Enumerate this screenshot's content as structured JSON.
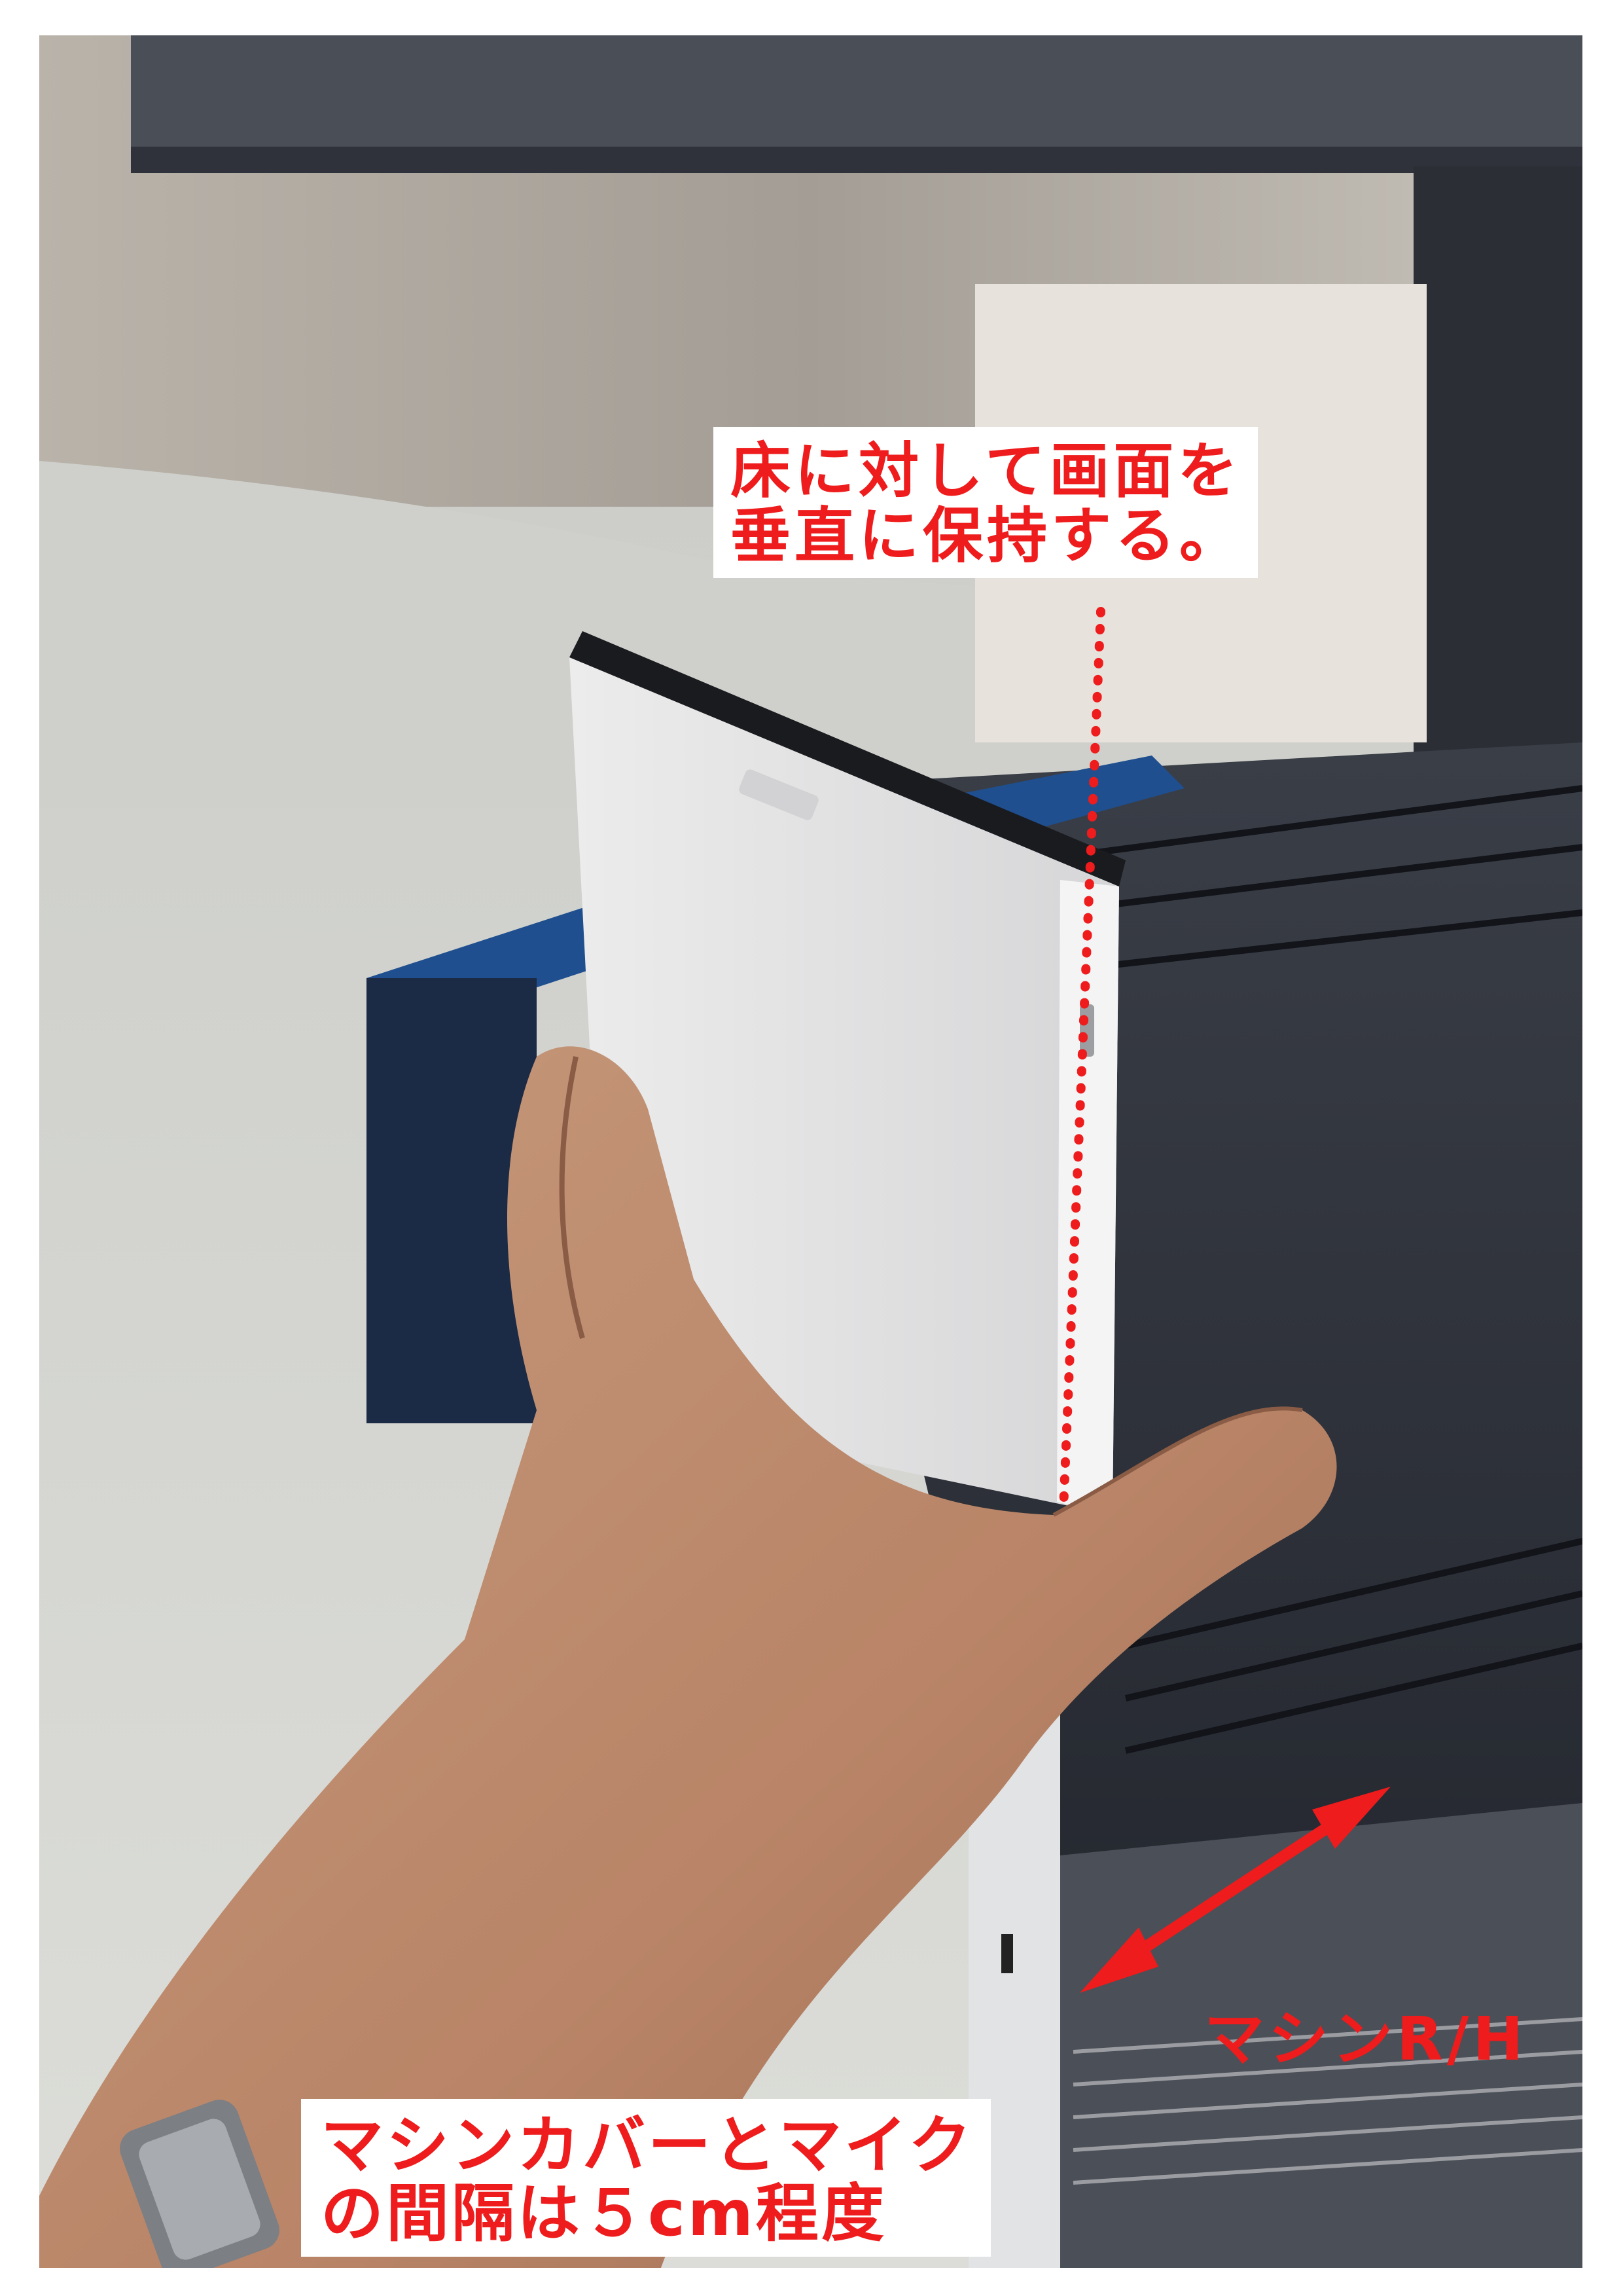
{
  "photo": {
    "subject": "hand holding a white handheld device vertically beside a copier machine cover"
  },
  "annotations": {
    "top_note": "床に対して画面を\n垂直に保持する。",
    "bottom_note": "マシンカバーとマイク\nの間隔は５cm程度",
    "machine_label": "マシンR/H"
  },
  "colors": {
    "annotation_red": "#ee1c1c",
    "machine_dark": "#2b2f38",
    "machine_blue": "#1f4f8f",
    "device_white": "#e9e9ea",
    "floor": "#d9dad6",
    "wall": "#a49f98"
  }
}
